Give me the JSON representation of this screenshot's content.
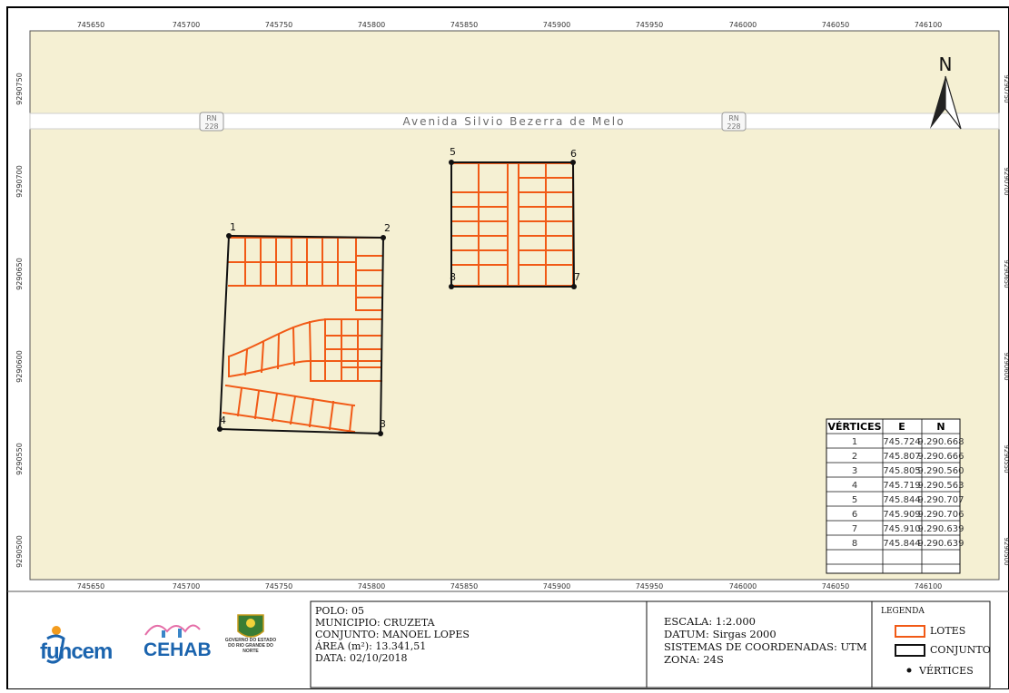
{
  "map": {
    "road_name": "Avenida Silvio Bezerra de Melo",
    "road_shield": {
      "prefix": "RN",
      "number": "228"
    },
    "north_label": "N",
    "colors": {
      "background": "#f5f0d3",
      "lotes": "#f15a16",
      "conjunto": "#111111",
      "road": "#ffffff",
      "frame": "#000000"
    },
    "grid_e": [
      "745650",
      "745700",
      "745750",
      "745800",
      "745850",
      "745900",
      "745950",
      "746000",
      "746050",
      "746100"
    ],
    "grid_n": [
      "9290750",
      "9290700",
      "9290650",
      "9290600",
      "9290550",
      "9290500"
    ],
    "vertex_labels": [
      "1",
      "2",
      "3",
      "4",
      "5",
      "6",
      "7",
      "8"
    ]
  },
  "vertices_table": {
    "headers": [
      "VÉRTICES",
      "E",
      "N"
    ],
    "rows": [
      [
        "1",
        "745.724",
        "9.290.668"
      ],
      [
        "2",
        "745.807",
        "9.290.666"
      ],
      [
        "3",
        "745.805",
        "9.290.560"
      ],
      [
        "4",
        "745.719",
        "9.290.563"
      ],
      [
        "5",
        "745.844",
        "9.290.707"
      ],
      [
        "6",
        "745.909",
        "9.290.706"
      ],
      [
        "7",
        "745.910",
        "9.290.639"
      ],
      [
        "8",
        "745.844",
        "9.290.639"
      ]
    ]
  },
  "info": {
    "polo": "POLO: 05",
    "municipio": "MUNICIPIO: CRUZETA",
    "conjunto": "CONJUNTO: MANOEL LOPES",
    "area": "ÁREA (m²): 13.341,51",
    "data": "DATA: 02/10/2018",
    "escala": "ESCALA: 1:2.000",
    "datum": "DATUM: Sirgas 2000",
    "sistema": "SISTEMAS DE COORDENADAS: UTM",
    "zona": "ZONA: 24S"
  },
  "legend": {
    "title": "LEGENDA",
    "items": [
      "LOTES",
      "CONJUNTO",
      "VÉRTICES"
    ]
  },
  "logos": {
    "funcem": "funcem",
    "cehab": "CEHAB",
    "governo": "GOVERNO DO ESTADO DO RIO GRANDE DO NORTE"
  }
}
